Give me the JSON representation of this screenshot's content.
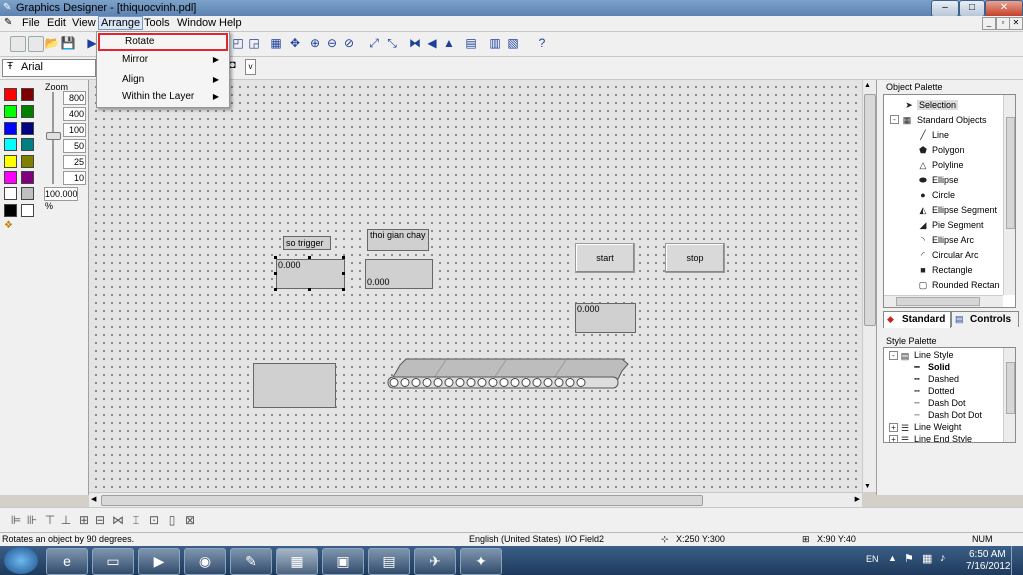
{
  "window": {
    "title": "Graphics Designer - [thiquocvinh.pdl]"
  },
  "menubar": {
    "items": [
      "File",
      "Edit",
      "View",
      "Arrange",
      "Tools",
      "Window",
      "Help"
    ]
  },
  "arrange_menu": {
    "items": [
      {
        "label": "Rotate",
        "submenu": false,
        "highlighted": true
      },
      {
        "label": "Mirror",
        "submenu": true
      },
      {
        "label": "Align",
        "submenu": true
      },
      {
        "label": "Within the Layer",
        "submenu": true
      }
    ]
  },
  "font": {
    "name": "Arial"
  },
  "zoom": {
    "label": "Zoom",
    "levels": [
      "800",
      "400",
      "100",
      "50",
      "25",
      "10"
    ],
    "current": "100.000 %"
  },
  "colors": {
    "palette": [
      "#ff0000",
      "#800000",
      "#00ff00",
      "#008000",
      "#0000ff",
      "#000080",
      "#00ffff",
      "#008080",
      "#ffff00",
      "#808000",
      "#ff00ff",
      "#800080",
      "#ffffff",
      "#c0c0c0",
      "#000000",
      "#ffffff"
    ]
  },
  "canvas": {
    "label_trigger": "so  trigger",
    "label_time": "thoi gian chay",
    "io_value_1": "0.000",
    "io_value_2": "0.000",
    "io_value_3": "0.000",
    "start_button": "start",
    "stop_button": "stop"
  },
  "object_palette": {
    "title": "Object Palette",
    "items": [
      "Selection",
      "Standard Objects",
      "Line",
      "Polygon",
      "Polyline",
      "Ellipse",
      "Circle",
      "Ellipse Segment",
      "Pie Segment",
      "Ellipse Arc",
      "Circular Arc",
      "Rectangle",
      "Rounded Rectang"
    ],
    "tabs": [
      "Standard",
      "Controls"
    ]
  },
  "style_palette": {
    "title": "Style Palette",
    "items": [
      "Line Style",
      "Solid",
      "Dashed",
      "Dotted",
      "Dash Dot",
      "Dash Dot Dot",
      "Line Weight",
      "Line End Style"
    ]
  },
  "statusbar": {
    "message": "Rotates an object by 90 degrees.",
    "language": "English (United States)",
    "object": "I/O Field2",
    "position": "X:250 Y:300",
    "size": "X:90 Y:40",
    "num": "NUM"
  },
  "taskbar": {
    "lang": "EN",
    "time": "6:50 AM",
    "date": "7/16/2012"
  }
}
